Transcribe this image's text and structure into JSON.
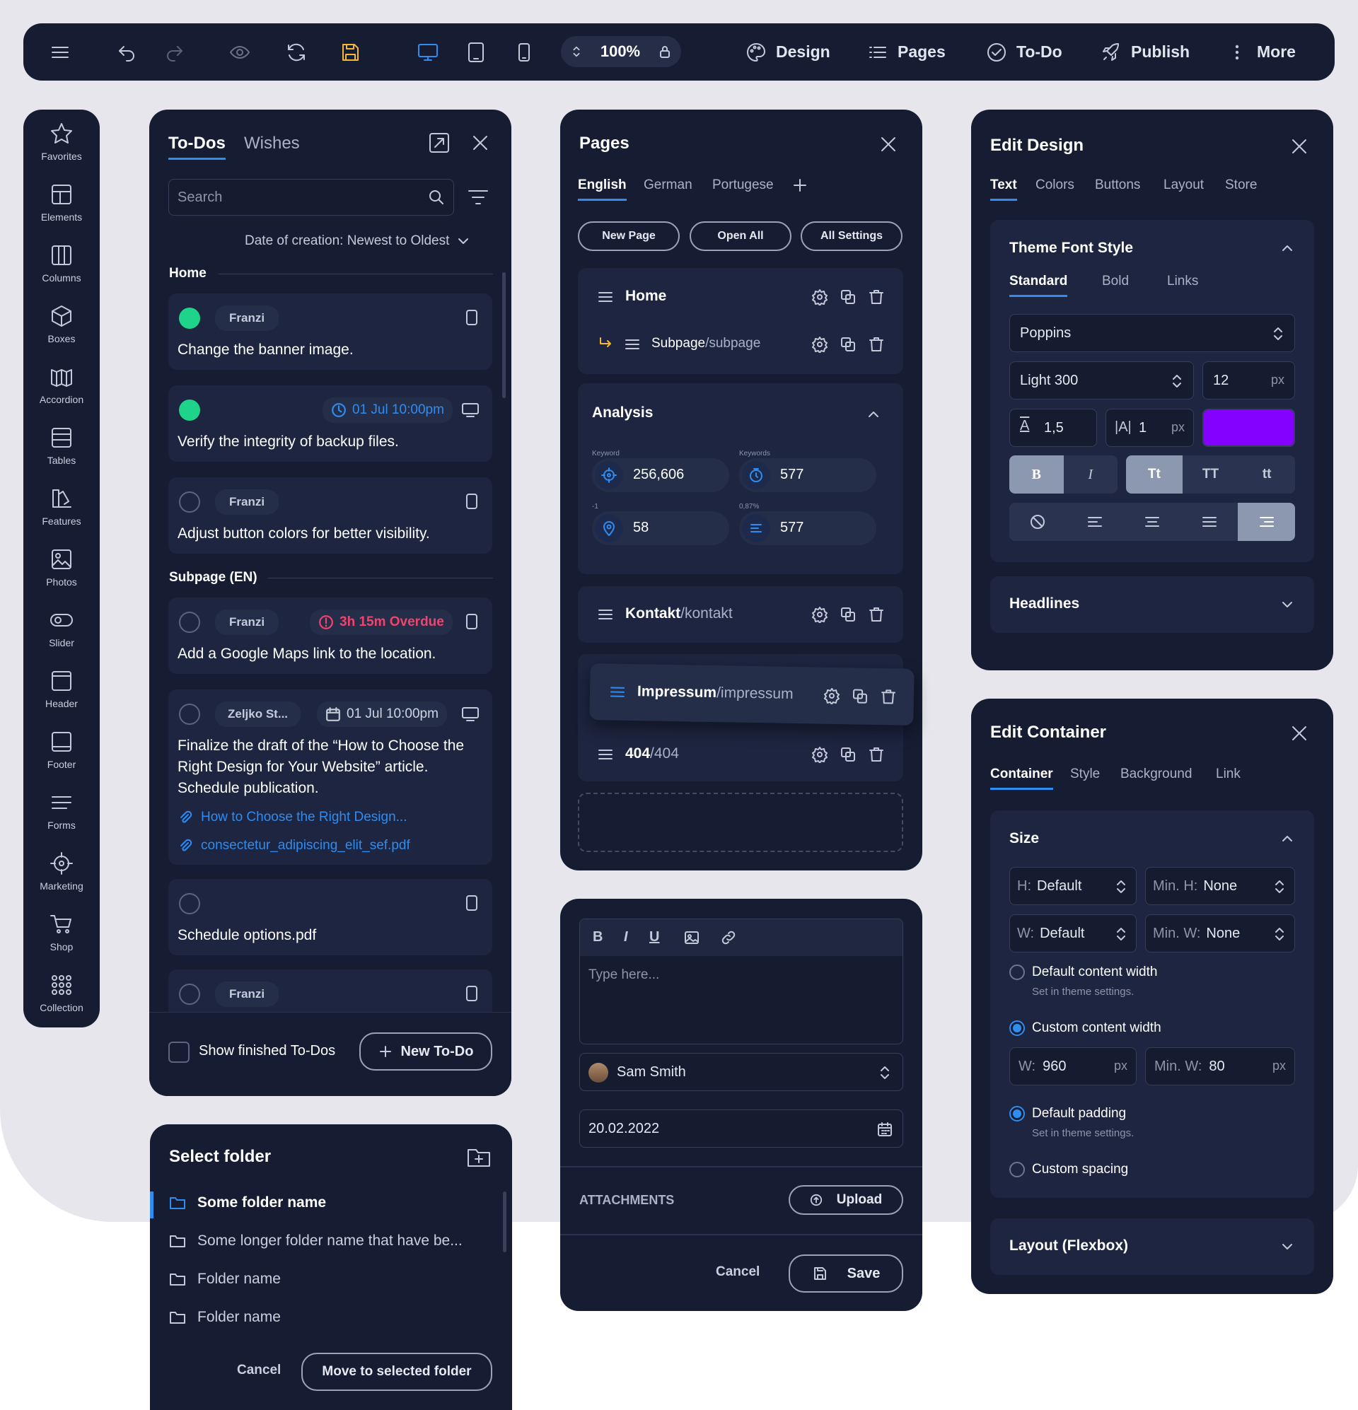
{
  "topbar": {
    "zoom": "100%",
    "design": "Design",
    "pages": "Pages",
    "todo": "To-Do",
    "publish": "Publish",
    "more": "More"
  },
  "sidebar": [
    "Favorites",
    "Elements",
    "Columns",
    "Boxes",
    "Accordion",
    "Tables",
    "Features",
    "Photos",
    "Slider",
    "Header",
    "Footer",
    "Forms",
    "Marketing",
    "Shop",
    "Collection"
  ],
  "todos": {
    "tab1": "To-Dos",
    "tab2": "Wishes",
    "search": "Search",
    "sort": "Date of creation: Newest to Oldest",
    "section1": "Home",
    "section2": "Subpage (EN)",
    "items": [
      {
        "user": "Franzi",
        "text": "Change the banner image."
      },
      {
        "date": "01 Jul 10:00pm",
        "text": "Verify the integrity of backup files."
      },
      {
        "user": "Franzi",
        "text": "Adjust button colors for better visibility."
      },
      {
        "user": "Franzi",
        "overdue": "3h 15m Overdue",
        "text": "Add a Google Maps link to the location."
      },
      {
        "user": "Zeljko St...",
        "date": "01 Jul 10:00pm",
        "text1": "Finalize the draft of the “How to Choose the",
        "text2": "Right Design for Your Website” article.",
        "text3": "Schedule publication.",
        "link1": "How to Choose the Right Design...",
        "link2": "consectetur_adipiscing_elit_sef.pdf"
      },
      {
        "text": "Schedule options.pdf"
      },
      {
        "user": "Franzi"
      }
    ],
    "show_finished": "Show finished To-Dos",
    "new_todo": "New To-Do"
  },
  "folder": {
    "title": "Select folder",
    "items": [
      "Some folder name",
      "Some longer folder name that have be...",
      "Folder name",
      "Folder name"
    ],
    "cancel": "Cancel",
    "move": "Move to selected folder"
  },
  "pages": {
    "title": "Pages",
    "langs": [
      "English",
      "German",
      "Portugese"
    ],
    "new_page": "New Page",
    "open_all": "Open All",
    "all_settings": "All Settings",
    "home": "Home",
    "subpage_a": "Subpage",
    "subpage_b": "/subpage",
    "analysis": "Analysis",
    "kw_label": "Keyword",
    "kw_value": "256,606",
    "kws_label": "Keywords",
    "kws_value": "577",
    "m1_label": "-1",
    "m1_value": "58",
    "pct_label": "0,87%",
    "pct_value": "577",
    "kontakt_a": "Kontakt",
    "kontakt_b": "/kontakt",
    "impressum_a": "Impressum",
    "impressum_b": "/impressum",
    "e404_a": "404",
    "e404_b": "/404"
  },
  "editor": {
    "placeholder": "Type here...",
    "user": "Sam Smith",
    "date": "20.02.2022",
    "attachments": "ATTACHMENTS",
    "upload": "Upload",
    "cancel": "Cancel",
    "save": "Save"
  },
  "design": {
    "title": "Edit Design",
    "tabs": [
      "Text",
      "Colors",
      "Buttons",
      "Layout",
      "Store"
    ],
    "section": "Theme Font Style",
    "subtabs": [
      "Standard",
      "Bold",
      "Links"
    ],
    "font": "Poppins",
    "weight": "Light 300",
    "size": "12",
    "unit": "px",
    "lh": "1,5",
    "ls": "1",
    "color": "#8400ff",
    "b": "B",
    "i": "I",
    "tt1": "Tt",
    "tt2": "TT",
    "tt3": "tt",
    "headlines": "Headlines"
  },
  "container": {
    "title": "Edit Container",
    "tabs": [
      "Container",
      "Style",
      "Background",
      "Link"
    ],
    "size": "Size",
    "h_label": "H:",
    "h_value": "Default",
    "minh_label": "Min. H:",
    "minh_value": "None",
    "w_label": "W:",
    "w_value": "Default",
    "minw_label": "Min. W:",
    "minw_value": "None",
    "default_width": "Default content width",
    "set_theme1": "Set in theme settings.",
    "custom_width": "Custom content width",
    "cw_label": "W:",
    "cw_value": "960",
    "cminw_label": "Min. W:",
    "cminw_value": "80",
    "px": "px",
    "default_padding": "Default padding",
    "set_theme2": "Set in theme settings.",
    "custom_spacing": "Custom spacing",
    "layout": "Layout (Flexbox)"
  }
}
